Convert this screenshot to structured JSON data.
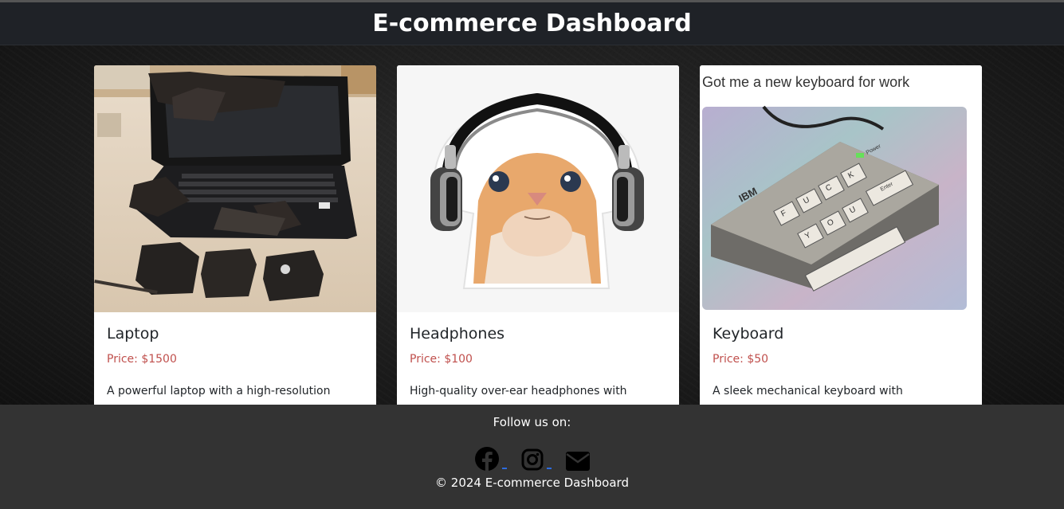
{
  "header": {
    "title": "E-commerce Dashboard"
  },
  "products": [
    {
      "name": "Laptop",
      "price": "Price: $1500",
      "description": "A powerful laptop with a high-resolution"
    },
    {
      "name": "Headphones",
      "price": "Price: $100",
      "description": "High-quality over-ear headphones with"
    },
    {
      "name": "Keyboard",
      "price": "Price: $50",
      "description": "A sleek mechanical keyboard with",
      "image_caption": "Got me a new keyboard for work",
      "image_brand": "IBM",
      "image_power_label": "Power",
      "image_keys_top": [
        "F",
        "U",
        "C",
        "K"
      ],
      "image_keys_bottom": [
        "Y",
        "O",
        "U"
      ],
      "image_enter_label": "Enter"
    }
  ],
  "footer": {
    "follow_label": "Follow us on:",
    "social_icons": [
      "facebook-icon",
      "instagram-icon",
      "mail-icon"
    ],
    "copyright": "© 2024 E-commerce Dashboard"
  },
  "colors": {
    "header_bg": "#1f2227",
    "footer_bg": "#333333",
    "price_text": "#c0504d",
    "card_bg": "#ffffff"
  }
}
